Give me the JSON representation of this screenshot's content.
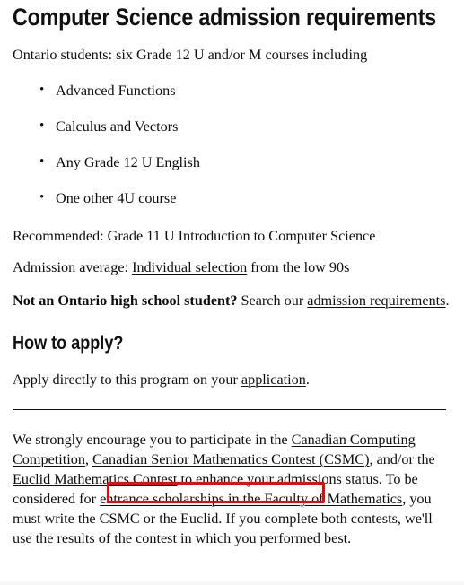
{
  "page": {
    "title": "Computer Science admission requirements",
    "intro": "Ontario students: six Grade 12 U and/or M courses including",
    "requirements": [
      "Advanced Functions",
      "Calculus and Vectors",
      "Any Grade 12 U English",
      "One other 4U course"
    ],
    "recommended": "Recommended: Grade 11 U Introduction to Computer Science",
    "admission_average": {
      "label": "Admission average: ",
      "link": "Individual selection",
      "suffix": " from the low 90s"
    },
    "not_ontario": {
      "lead": "Not an Ontario high school student?",
      "middle": " Search our ",
      "link": "admission requirements",
      "suffix": "."
    },
    "how_to_apply": {
      "heading": "How to apply?",
      "text_before": "Apply directly to this program on your ",
      "link": "application",
      "text_after": "."
    },
    "contests": {
      "part1": "We strongly encourage you to participate in the ",
      "link1": "Canadian Computing Competition",
      "part2": ", ",
      "link2": "Canadian Senior Mathematics Contest (CSMC)",
      "part3": ", and/or the ",
      "link3": "Euclid Mathematics Contest",
      "part4": " to enhance your admissions status. To be considered for ",
      "link4": "entrance scholarships in the Faculty of Mathematics",
      "part5": ", you must write the CSMC or the Euclid. If you complete both contests, we'll use the results of the contest in which you performed best."
    }
  },
  "annotation": {
    "color": "#ff0000",
    "target": "Euclid Mathematics Contest"
  }
}
